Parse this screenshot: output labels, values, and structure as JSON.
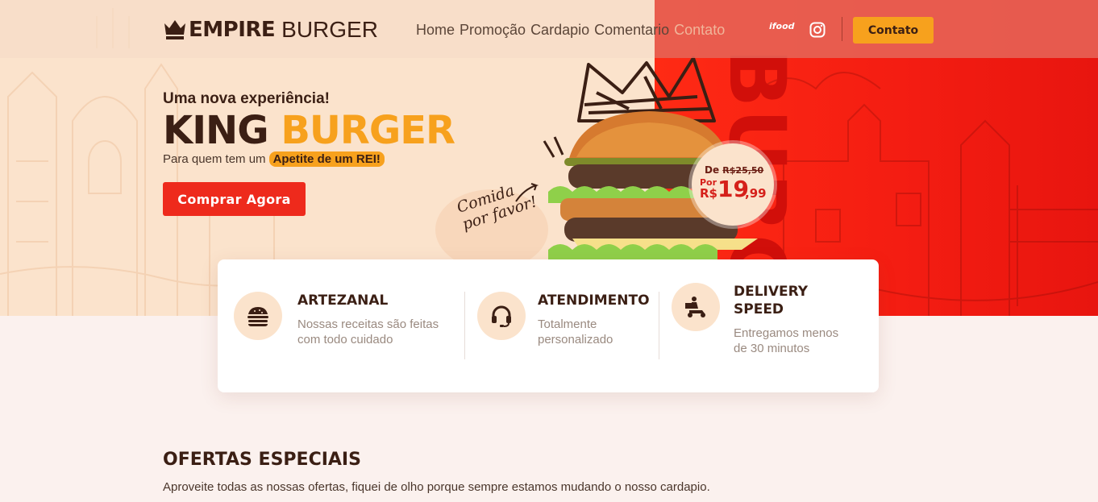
{
  "brand": {
    "strong": "EMPIRE",
    "light": "BURGER"
  },
  "nav": {
    "items": [
      "Home",
      "Promoção",
      "Cardapio",
      "Comentario",
      "Contato"
    ]
  },
  "header": {
    "ifood": "ifood",
    "contact_button": "Contato"
  },
  "hero": {
    "tagline": "Uma nova experiência!",
    "title_part1": "KING",
    "title_part2": "BURGER",
    "subline_text": "Para quem tem um",
    "subline_highlight": "Apetite de um REI!",
    "buy_button": "Comprar Agora",
    "handwriting_line1": "Comida",
    "handwriting_line2": "por favor!"
  },
  "price": {
    "old_label": "De",
    "old_value": "R$25,50",
    "new_label": "Por",
    "currency": "R$",
    "new_whole": "19",
    "new_cents": ",99"
  },
  "features": [
    {
      "icon": "burger-icon",
      "title": "ARTEZANAL",
      "text_line1": "Nossas receitas são feitas",
      "text_line2": "com todo cuidado"
    },
    {
      "icon": "headset-icon",
      "title": "ATENDIMENTO",
      "text_line1": "Totalmente",
      "text_line2": "personalizado"
    },
    {
      "icon": "delivery-icon",
      "title_line1": "DELIVERY",
      "title_line2": "SPEED",
      "text_line1": "Entregamos menos",
      "text_line2": "de 30 minutos"
    }
  ],
  "offers": {
    "title": "OFERTAS ESPECIAIS",
    "subtitle": "Aproveite todas as nossas ofertas, fiquei de olho porque sempre estamos mudando o nosso cardapio."
  },
  "colors": {
    "accent": "#f7a11d",
    "red": "#ee2a1c",
    "dark": "#3b1f14",
    "cream": "#fbe3cc"
  }
}
